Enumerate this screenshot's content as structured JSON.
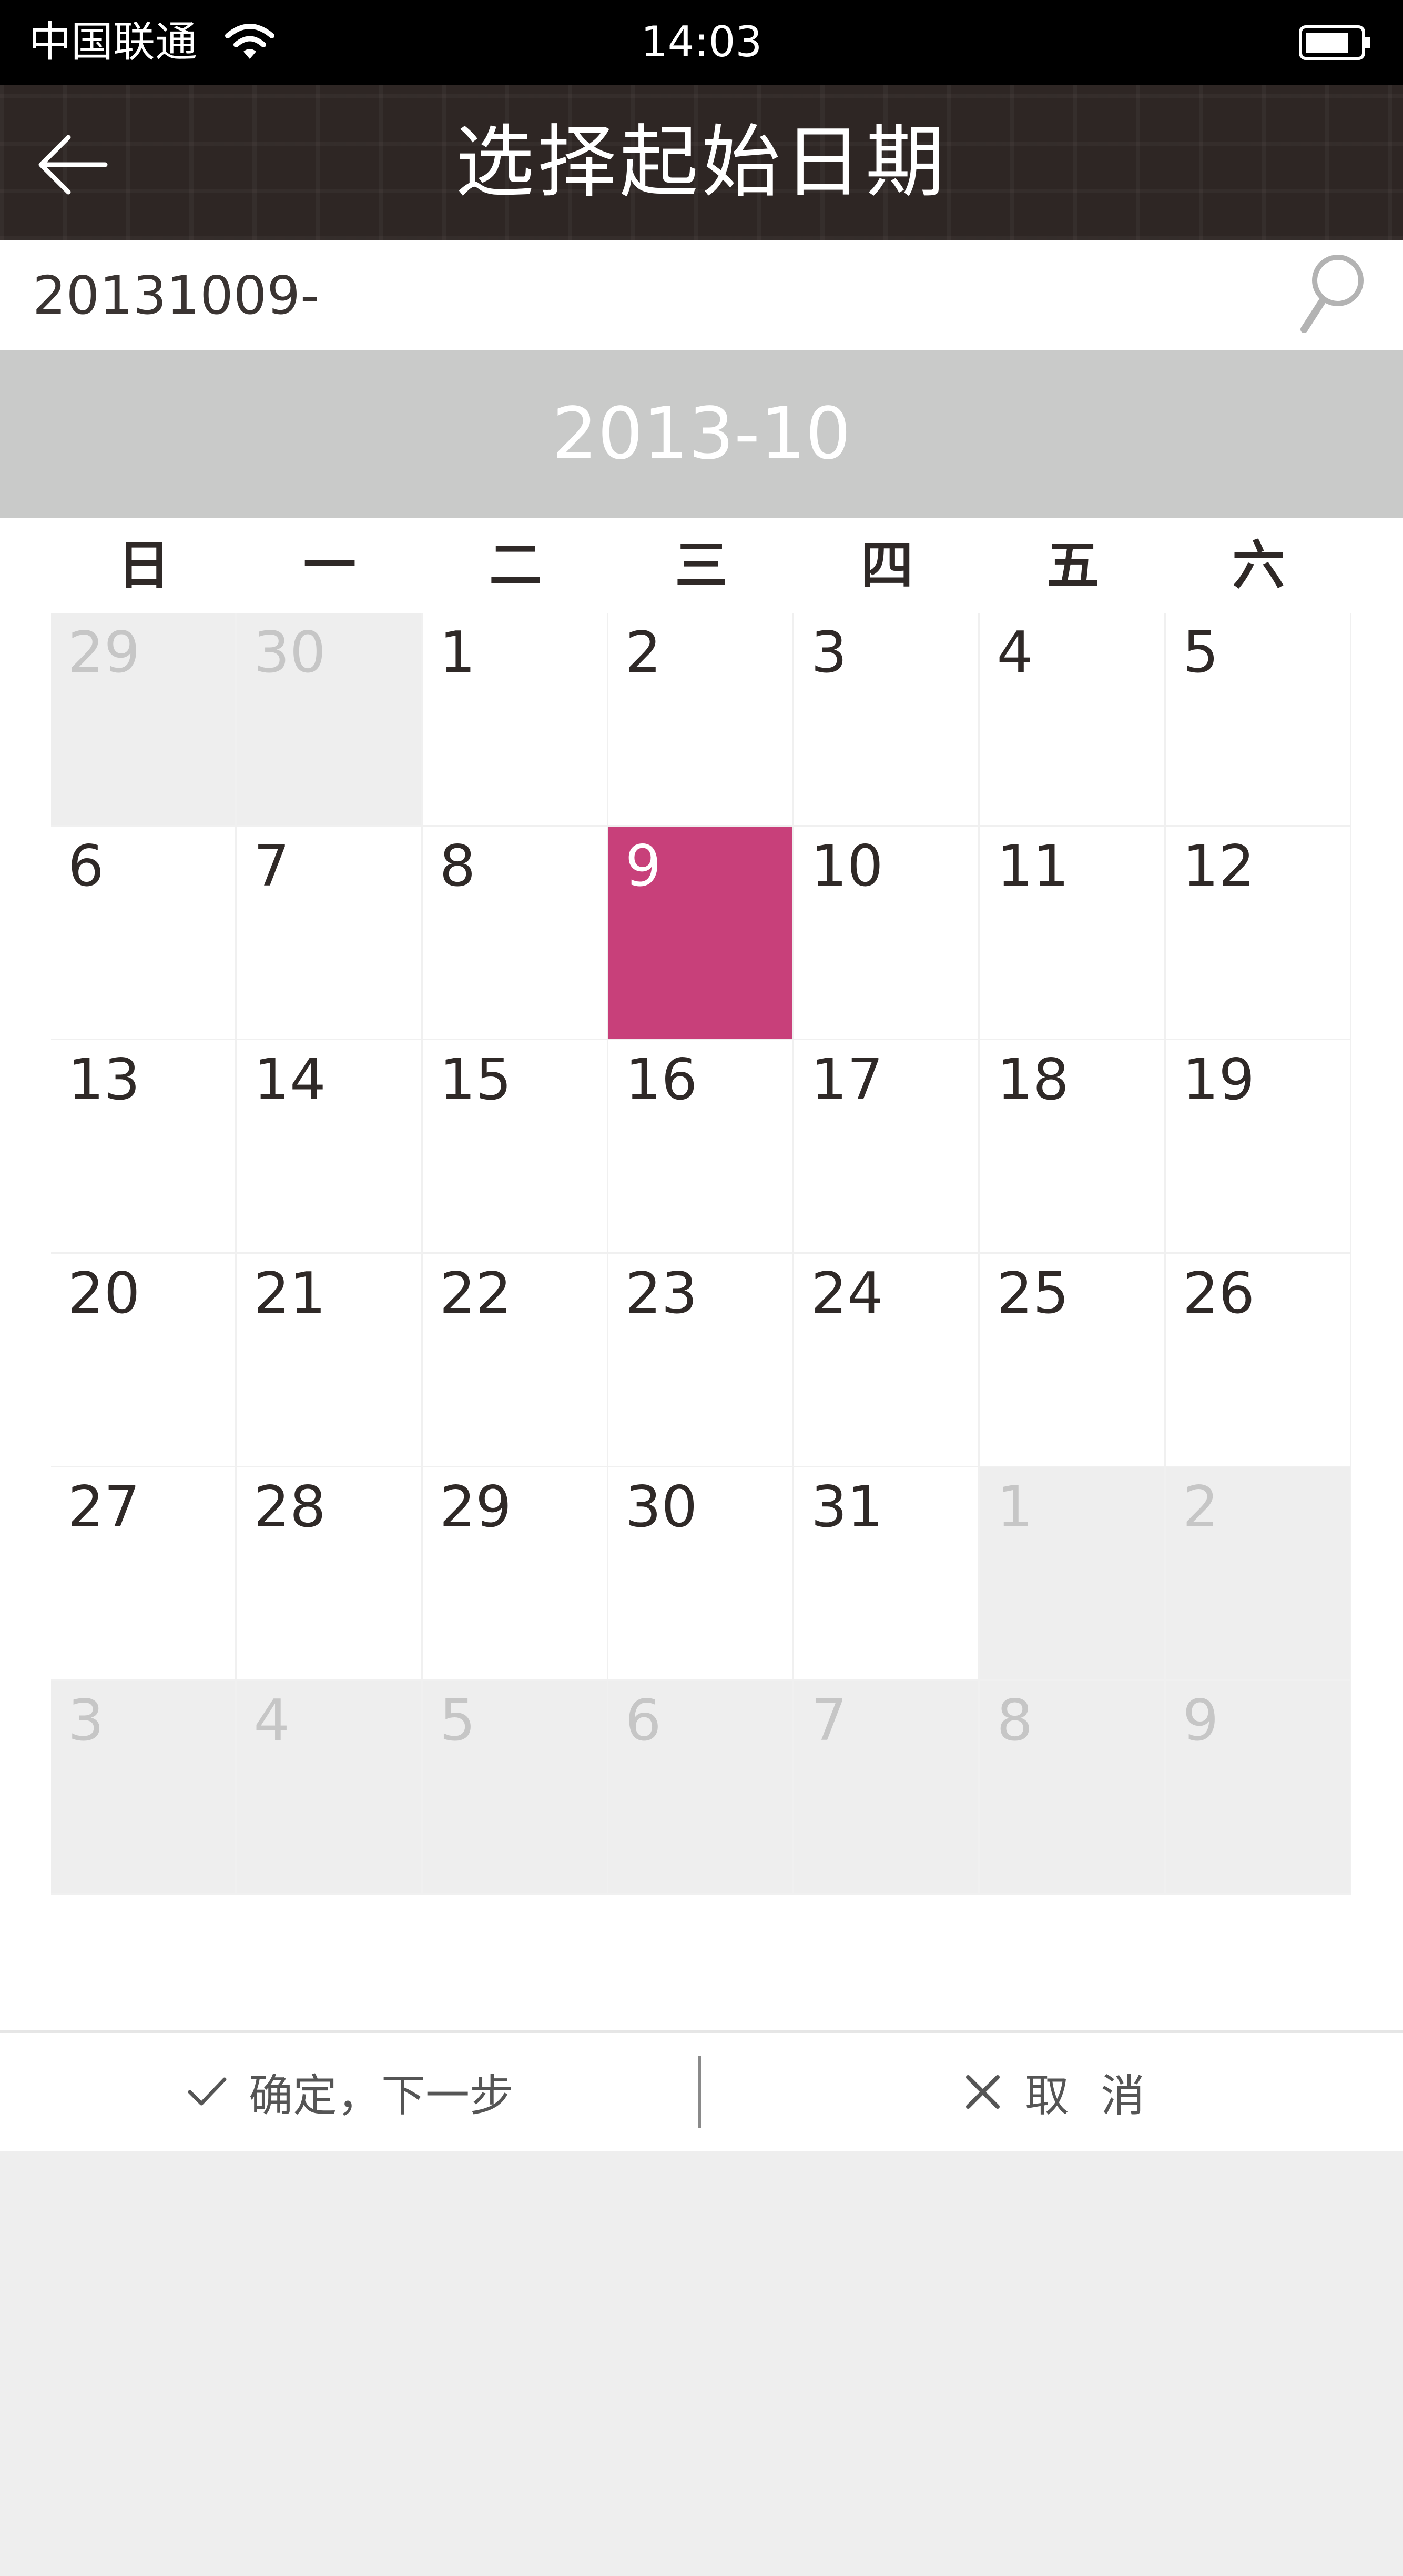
{
  "status_bar": {
    "carrier": "中国联通",
    "time": "14:03"
  },
  "header": {
    "title": "选择起始日期"
  },
  "search": {
    "value": "20131009-"
  },
  "month_label": "2013-10",
  "weekdays": [
    "日",
    "一",
    "二",
    "三",
    "四",
    "五",
    "六"
  ],
  "weeks": [
    [
      {
        "d": "29",
        "other": true
      },
      {
        "d": "30",
        "other": true
      },
      {
        "d": "1"
      },
      {
        "d": "2"
      },
      {
        "d": "3"
      },
      {
        "d": "4"
      },
      {
        "d": "5"
      }
    ],
    [
      {
        "d": "6"
      },
      {
        "d": "7"
      },
      {
        "d": "8"
      },
      {
        "d": "9",
        "selected": true
      },
      {
        "d": "10"
      },
      {
        "d": "11"
      },
      {
        "d": "12"
      }
    ],
    [
      {
        "d": "13"
      },
      {
        "d": "14"
      },
      {
        "d": "15"
      },
      {
        "d": "16"
      },
      {
        "d": "17"
      },
      {
        "d": "18"
      },
      {
        "d": "19"
      }
    ],
    [
      {
        "d": "20"
      },
      {
        "d": "21"
      },
      {
        "d": "22"
      },
      {
        "d": "23"
      },
      {
        "d": "24"
      },
      {
        "d": "25"
      },
      {
        "d": "26"
      }
    ],
    [
      {
        "d": "27"
      },
      {
        "d": "28"
      },
      {
        "d": "29"
      },
      {
        "d": "30"
      },
      {
        "d": "31"
      },
      {
        "d": "1",
        "other": true
      },
      {
        "d": "2",
        "other": true
      }
    ],
    [
      {
        "d": "3",
        "other": true
      },
      {
        "d": "4",
        "other": true
      },
      {
        "d": "5",
        "other": true
      },
      {
        "d": "6",
        "other": true
      },
      {
        "d": "7",
        "other": true
      },
      {
        "d": "8",
        "other": true
      },
      {
        "d": "9",
        "other": true
      }
    ]
  ],
  "actions": {
    "confirm_label": "确定，下一步",
    "cancel_label": "取消"
  },
  "colors": {
    "selected": "#c8407a",
    "header_bg": "#2e2624",
    "month_banner": "#c9cac9"
  },
  "icons": [
    "wifi-icon",
    "battery-icon",
    "back-arrow-icon",
    "search-icon",
    "check-icon",
    "close-icon"
  ]
}
